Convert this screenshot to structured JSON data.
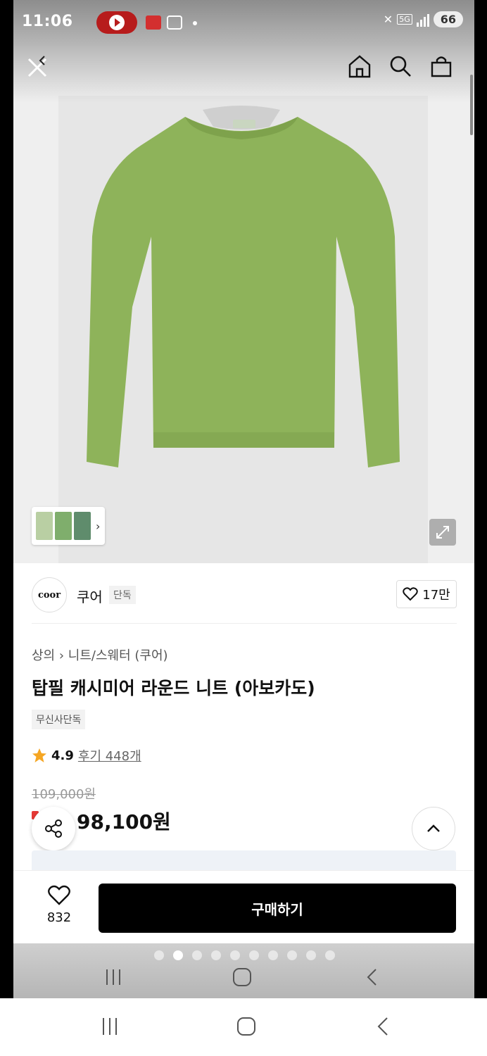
{
  "status_bar": {
    "time": "11:06",
    "network": "5G",
    "battery": "66"
  },
  "brand": {
    "logo_text": "coor",
    "name": "쿠어",
    "tag": "단독",
    "likes": "17만"
  },
  "product": {
    "breadcrumb_main": "상의",
    "breadcrumb_sub": "니트/스웨터 (쿠어)",
    "title": "탑필 캐시미어 라운드 니트 (아보카도)",
    "exclusive_badge": "무신사단독",
    "rating": "4.9",
    "reviews": "후기 448개",
    "original_price": "109,000원",
    "sale_price": "98,100원",
    "image_colors": {
      "sweater": "#8eb35a",
      "background": "#e6e6e6"
    },
    "thumbnail_colors": [
      "#b9cfa3",
      "#7fae6c",
      "#5f8c6c"
    ]
  },
  "purchase_bar": {
    "wish_count": "832",
    "buy_label": "구매하기"
  },
  "icons": {
    "close": "close-icon",
    "back": "chevron-left-icon",
    "home": "home-icon",
    "search": "search-icon",
    "cart": "shopping-bag-icon",
    "share": "share-icon",
    "scroll_top": "chevron-up-icon",
    "expand": "expand-icon",
    "heart": "heart-icon",
    "star": "star-icon"
  },
  "colors": {
    "accent_black": "#000000",
    "star": "#f5a623",
    "sale_red": "#e53935"
  }
}
